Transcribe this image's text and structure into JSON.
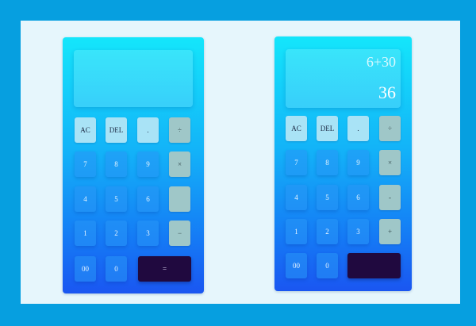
{
  "colors": {
    "frame": "#069fe0",
    "panel": "#e6f6fc",
    "gradient_top": "#14e6fb",
    "gradient_bottom": "#1a56f1",
    "top_key": "#a9e3f6",
    "operator_key": "#9fc7c8",
    "equals_key": "#20093f"
  },
  "left_calc": {
    "display": {
      "expression": "",
      "result": ""
    },
    "keys": {
      "ac": "AC",
      "del": "DEL",
      "dot": ".",
      "op1": "÷",
      "n7": "7",
      "n8": "8",
      "n9": "9",
      "op2": "×",
      "n4": "4",
      "n5": "5",
      "n6": "6",
      "op3": "",
      "n1": "1",
      "n2": "2",
      "n3": "3",
      "op4": "−",
      "n00": "00",
      "n0": "0",
      "eq": "="
    }
  },
  "right_calc": {
    "display": {
      "expression": "6+30",
      "result": "36"
    },
    "keys": {
      "ac": "AC",
      "del": "DEL",
      "dot": ".",
      "op1": "÷",
      "n7": "7",
      "n8": "8",
      "n9": "9",
      "op2": "×",
      "n4": "4",
      "n5": "5",
      "n6": "6",
      "op3": "-",
      "n1": "1",
      "n2": "2",
      "n3": "3",
      "op4": "+",
      "n00": "00",
      "n0": "0",
      "eq": ""
    }
  }
}
